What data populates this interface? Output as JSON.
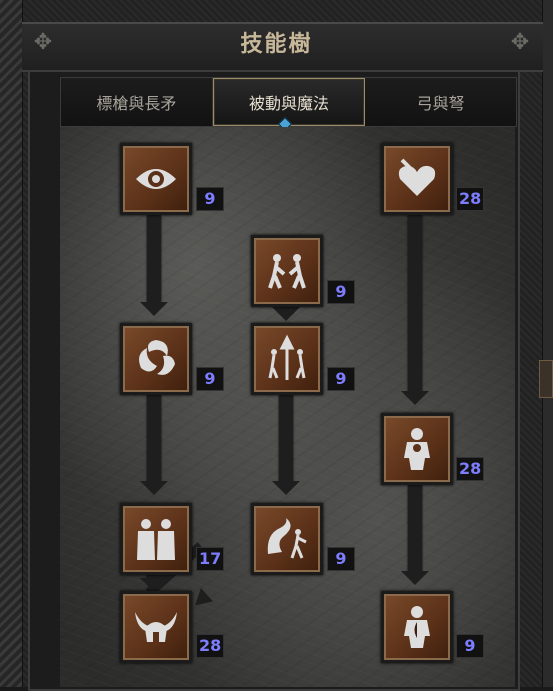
{
  "title": "技能樹",
  "tabs": [
    {
      "label": "標槍與長矛",
      "active": false
    },
    {
      "label": "被動與魔法",
      "active": true
    },
    {
      "label": "弓與弩",
      "active": false
    }
  ],
  "skills": [
    {
      "icon": "eye-icon",
      "level": "9"
    },
    {
      "icon": "heart-dagger-icon",
      "level": "28"
    },
    {
      "icon": "twin-figures-icon",
      "level": "9"
    },
    {
      "icon": "swirl-icon",
      "level": "9"
    },
    {
      "icon": "trident-figures-icon",
      "level": "9"
    },
    {
      "icon": "body-silhouette-icon",
      "level": "28"
    },
    {
      "icon": "two-bodies-icon",
      "level": "17"
    },
    {
      "icon": "spirit-figure-icon",
      "level": "9"
    },
    {
      "icon": "horned-helm-icon",
      "level": "28"
    },
    {
      "icon": "half-silhouette-icon",
      "level": "9"
    }
  ],
  "colors": {
    "accent_level": "#7d7dff",
    "skill_frame": "#5a3018",
    "title": "#c8b89a"
  }
}
